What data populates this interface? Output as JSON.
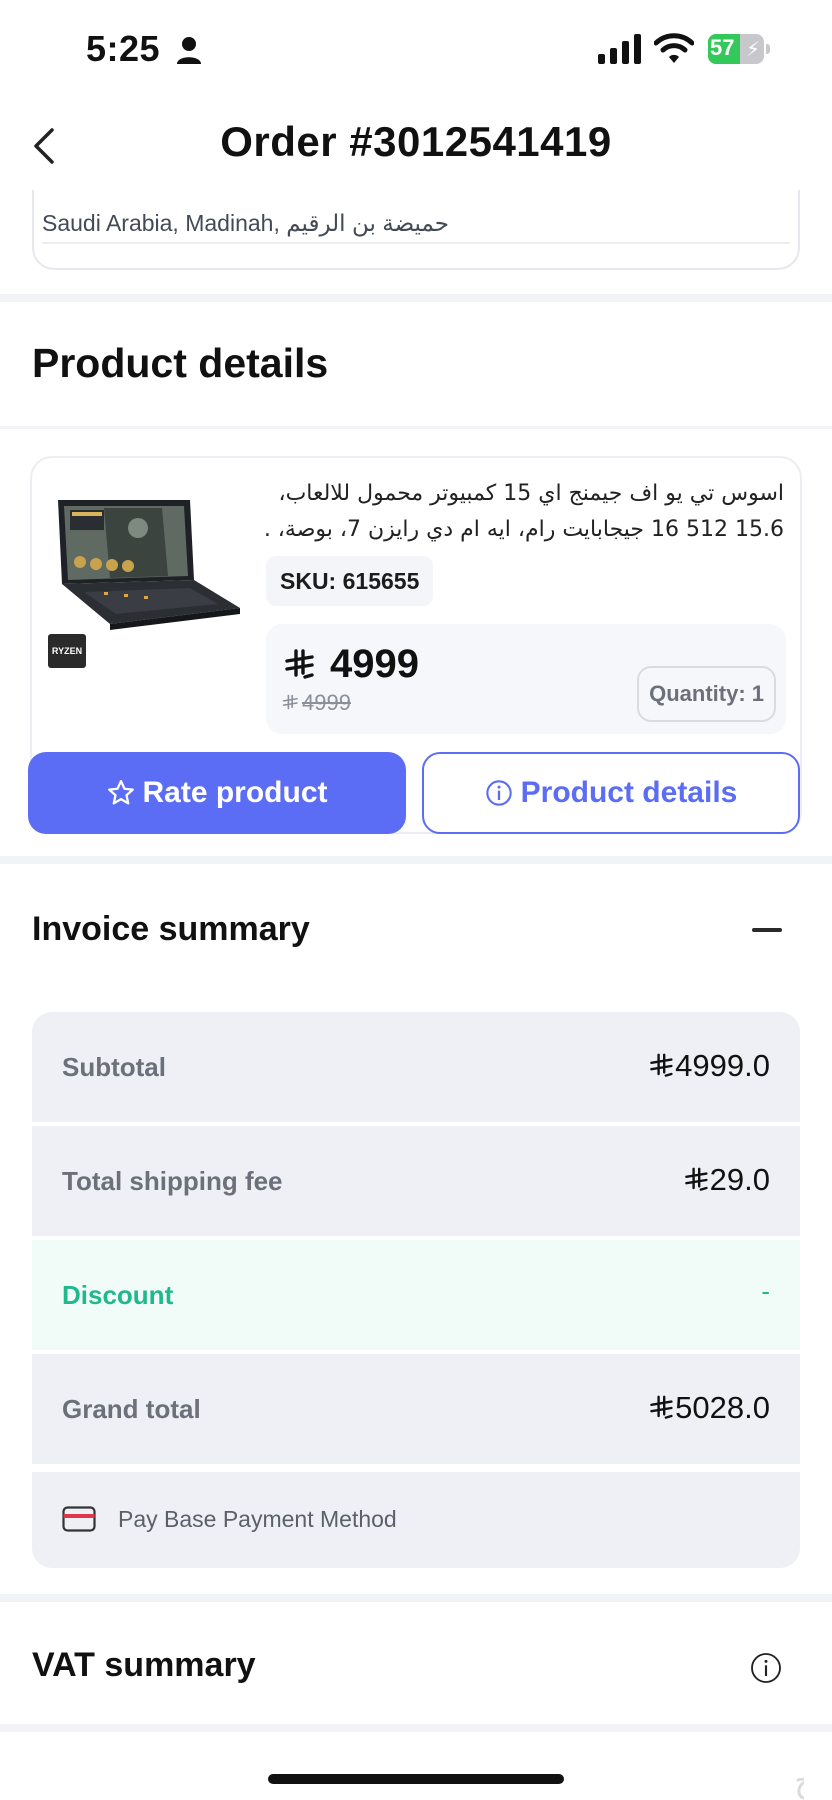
{
  "status_bar": {
    "time": "5:25",
    "battery": "57",
    "battery_level": 0.57,
    "battery_color": "#34c759"
  },
  "header": {
    "title": "Order #3012541419",
    "back_icon": "chevron-left-icon"
  },
  "address": {
    "text": "Saudi Arabia, Madinah, حميضة بن الرقيم"
  },
  "product_section": {
    "title": "Product details"
  },
  "product": {
    "name_line1": "اسوس تي يو اف جيمنج اي 15 كمبيوتر محمول للالعاب،",
    "name_line2": "15.6  512  ‏16 جيجابايت رام، ايه ام دي رايزن 7، بوصة، ...",
    "image_badge": "RYZEN",
    "sku": "SKU: 615655",
    "currency_symbol": "⃁",
    "price": "4999",
    "old_price": "4999",
    "quantity": "Quantity: 1"
  },
  "actions": {
    "rate_label": "Rate product",
    "rate_icon": "star-icon",
    "details_label": "Product details",
    "details_icon": "info-icon",
    "accent_color": "#5b6cf5"
  },
  "invoice": {
    "title": "Invoice summary",
    "rows": [
      {
        "label": "Subtotal",
        "value": "4999.0"
      },
      {
        "label": "Total shipping fee",
        "value": "29.0"
      },
      {
        "label": "Discount",
        "value": "-"
      },
      {
        "label": "Grand total",
        "value": "5028.0"
      }
    ],
    "payment_method": "Pay Base Payment Method",
    "discount_color": "#20b98c"
  },
  "vat": {
    "title": "VAT summary"
  },
  "watermark": {
    "text": "حراج"
  }
}
